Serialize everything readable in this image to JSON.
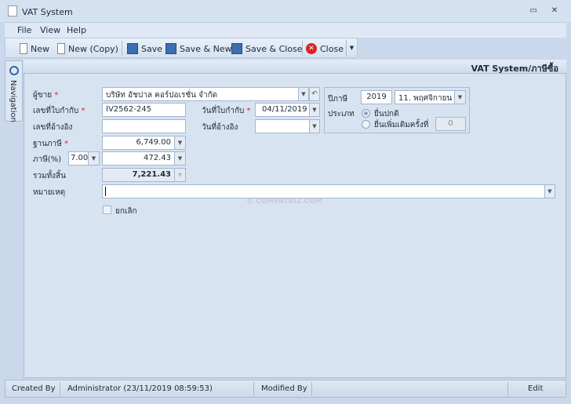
{
  "window": {
    "title": "VAT System",
    "min": "▭",
    "close": "✕"
  },
  "menu": [
    "File",
    "View",
    "Help"
  ],
  "toolbar": {
    "new": "New",
    "new_copy": "New (Copy)",
    "save": "Save",
    "save_new": "Save & New",
    "save_close": "Save & Close",
    "close": "Close"
  },
  "nav": {
    "label": "Navigation"
  },
  "header": {
    "breadcrumb": "VAT System/ภาษีซื้อ"
  },
  "form": {
    "seller_label": "ผู้ขาย",
    "seller": "บริษัท อัชปาล คอร์ปอเรชั่น จำกัด",
    "invoice_no_label": "เลขที่ใบกำกับ",
    "invoice_no": "IV2562-245",
    "invoice_date_label": "วันที่ใบกำกับ",
    "invoice_date": "04/11/2019",
    "ref_no_label": "เลขที่อ้างอิง",
    "ref_no": "",
    "ref_date_label": "วันที่อ้างอิง",
    "ref_date": "",
    "tax_base_label": "ฐานภาษี",
    "tax_base": "6,749.00",
    "tax_rate_label": "ภาษี(%)",
    "tax_rate": "7.00",
    "tax_amount": "472.43",
    "total_label": "รวมทั้งสิ้น",
    "total": "7,221.43",
    "note_label": "หมายเหตุ",
    "note": "",
    "cancel_label": "ยกเลิก",
    "required": "*"
  },
  "group": {
    "tax_year_label": "ปีภาษี",
    "tax_year": "2019",
    "month": "11. พฤศจิกายน",
    "type_label": "ประเภท",
    "normal": "ยื่นปกติ",
    "additional": "ยื่นเพิ่มเติมครั้งที่",
    "additional_no": "0"
  },
  "watermark": "© COMPATBIZ.COM",
  "status": {
    "created_by_label": "Created By",
    "created_by": "Administrator (23/11/2019 08:59:53)",
    "modified_by_label": "Modified By",
    "mode": "Edit"
  }
}
